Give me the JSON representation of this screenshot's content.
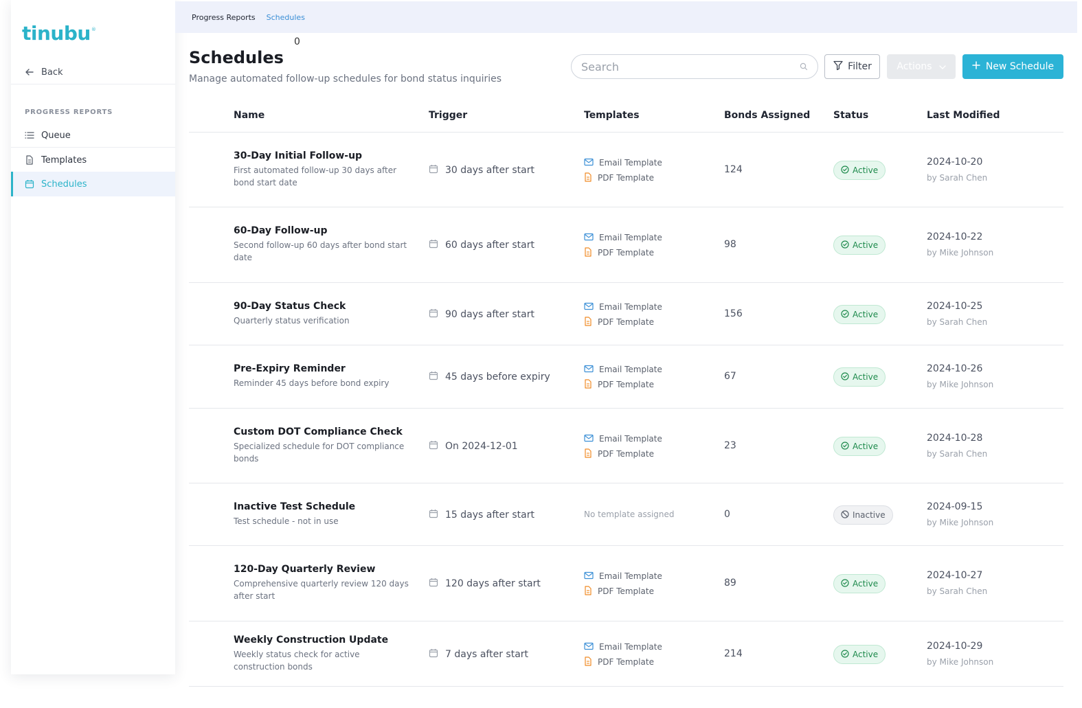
{
  "brand": {
    "logo_text": "tinubu",
    "logo_mark": "®"
  },
  "sidebar": {
    "back_label": "Back",
    "section_title": "PROGRESS REPORTS",
    "items": [
      {
        "label": "Queue",
        "icon": "list-icon",
        "active": false
      },
      {
        "label": "Templates",
        "icon": "document-icon",
        "active": false
      },
      {
        "label": "Schedules",
        "icon": "calendar-icon",
        "active": true
      }
    ]
  },
  "breadcrumb": [
    "Progress Reports",
    "Schedules"
  ],
  "counter": "0",
  "page": {
    "title": "Schedules",
    "subtitle": "Manage automated follow-up schedules for bond status inquiries"
  },
  "toolbar": {
    "search_placeholder": "Search",
    "filter_label": "Filter",
    "actions_label": "Actions",
    "new_label": "New Schedule"
  },
  "table": {
    "columns": [
      "Name",
      "Trigger",
      "Templates",
      "Bonds Assigned",
      "Status",
      "Last Modified"
    ],
    "rows": [
      {
        "name": "30-Day Initial Follow-up",
        "description": "First automated follow-up 30 days after bond start date",
        "trigger": "30 days after start",
        "templates": [
          "Email Template",
          "PDF Template"
        ],
        "bonds": "124",
        "status": "Active",
        "date": "2024-10-20",
        "by": "by Sarah Chen"
      },
      {
        "name": "60-Day Follow-up",
        "description": "Second follow-up 60 days after bond start date",
        "trigger": "60 days after start",
        "templates": [
          "Email Template",
          "PDF Template"
        ],
        "bonds": "98",
        "status": "Active",
        "date": "2024-10-22",
        "by": "by Mike Johnson"
      },
      {
        "name": "90-Day Status Check",
        "description": "Quarterly status verification",
        "trigger": "90 days after start",
        "templates": [
          "Email Template",
          "PDF Template"
        ],
        "bonds": "156",
        "status": "Active",
        "date": "2024-10-25",
        "by": "by Sarah Chen"
      },
      {
        "name": "Pre-Expiry Reminder",
        "description": "Reminder 45 days before bond expiry",
        "trigger": "45 days before expiry",
        "templates": [
          "Email Template",
          "PDF Template"
        ],
        "bonds": "67",
        "status": "Active",
        "date": "2024-10-26",
        "by": "by Mike Johnson"
      },
      {
        "name": "Custom DOT Compliance Check",
        "description": "Specialized schedule for DOT compliance bonds",
        "trigger": "On 2024-12-01",
        "templates": [
          "Email Template",
          "PDF Template"
        ],
        "bonds": "23",
        "status": "Active",
        "date": "2024-10-28",
        "by": "by Sarah Chen"
      },
      {
        "name": "Inactive Test Schedule",
        "description": "Test schedule - not in use",
        "trigger": "15 days after start",
        "templates": [],
        "no_template": "No template assigned",
        "bonds": "0",
        "status": "Inactive",
        "date": "2024-09-15",
        "by": "by Mike Johnson"
      },
      {
        "name": "120-Day Quarterly Review",
        "description": "Comprehensive quarterly review 120 days after start",
        "trigger": "120 days after start",
        "templates": [
          "Email Template",
          "PDF Template"
        ],
        "bonds": "89",
        "status": "Active",
        "date": "2024-10-27",
        "by": "by Sarah Chen"
      },
      {
        "name": "Weekly Construction Update",
        "description": "Weekly status check for active construction bonds",
        "trigger": "7 days after start",
        "templates": [
          "Email Template",
          "PDF Template"
        ],
        "bonds": "214",
        "status": "Active",
        "date": "2024-10-29",
        "by": "by Mike Johnson"
      }
    ]
  },
  "colors": {
    "accent": "#2bb3c9",
    "primary_button": "#2bb3d6",
    "active_badge": "#1e8a4c",
    "email_icon": "#3b8fd6",
    "pdf_icon": "#f08a24"
  }
}
